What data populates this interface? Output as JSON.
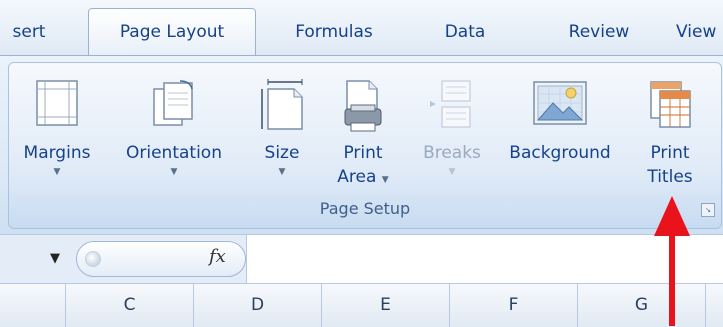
{
  "tabs": [
    {
      "label": "sert",
      "active": false
    },
    {
      "label": "Page Layout",
      "active": true
    },
    {
      "label": "Formulas",
      "active": false
    },
    {
      "label": "Data",
      "active": false
    },
    {
      "label": "Review",
      "active": false
    },
    {
      "label": "View",
      "active": false
    }
  ],
  "ribbon": {
    "group_title": "Page Setup",
    "buttons": {
      "margins": {
        "label": "Margins",
        "icon": "margins-icon"
      },
      "orientation": {
        "label": "Orientation",
        "icon": "orientation-icon"
      },
      "size": {
        "label": "Size",
        "icon": "size-icon"
      },
      "print_area": {
        "line1": "Print",
        "line2": "Area",
        "icon": "print-area-icon"
      },
      "breaks": {
        "label": "Breaks",
        "icon": "breaks-icon",
        "disabled": true
      },
      "background": {
        "label": "Background",
        "icon": "background-icon"
      },
      "print_titles": {
        "line1": "Print",
        "line2": "Titles",
        "icon": "print-titles-icon"
      }
    }
  },
  "formula_bar": {
    "fx_label": "fx"
  },
  "columns": [
    "C",
    "D",
    "E",
    "F",
    "G"
  ],
  "colors": {
    "annotation_arrow": "#e8131b",
    "ribbon_text": "#15428b"
  }
}
